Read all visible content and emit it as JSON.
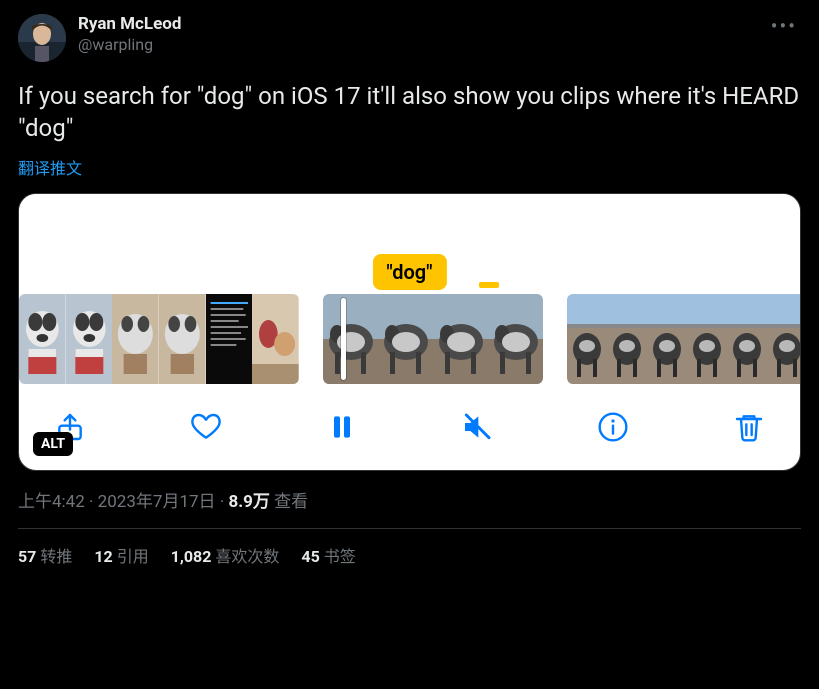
{
  "author": {
    "display_name": "Ryan McLeod",
    "handle": "@warpling"
  },
  "tweet_text": "If you search for \"dog\" on iOS 17 it'll also show you clips where it's HEARD \"dog\"",
  "translate_label": "翻译推文",
  "media": {
    "search_term_label": "\"dog\"",
    "alt_badge": "ALT",
    "controls": {
      "share": "share",
      "like": "like",
      "pause": "pause",
      "mute": "mute",
      "info": "info",
      "trash": "trash"
    }
  },
  "meta": {
    "time": "上午4:42",
    "date": "2023年7月17日",
    "views_count": "8.9万",
    "views_label": "查看"
  },
  "stats": {
    "retweets_count": "57",
    "retweets_label": "转推",
    "quotes_count": "12",
    "quotes_label": "引用",
    "likes_count": "1,082",
    "likes_label": "喜欢次数",
    "bookmarks_count": "45",
    "bookmarks_label": "书签"
  }
}
